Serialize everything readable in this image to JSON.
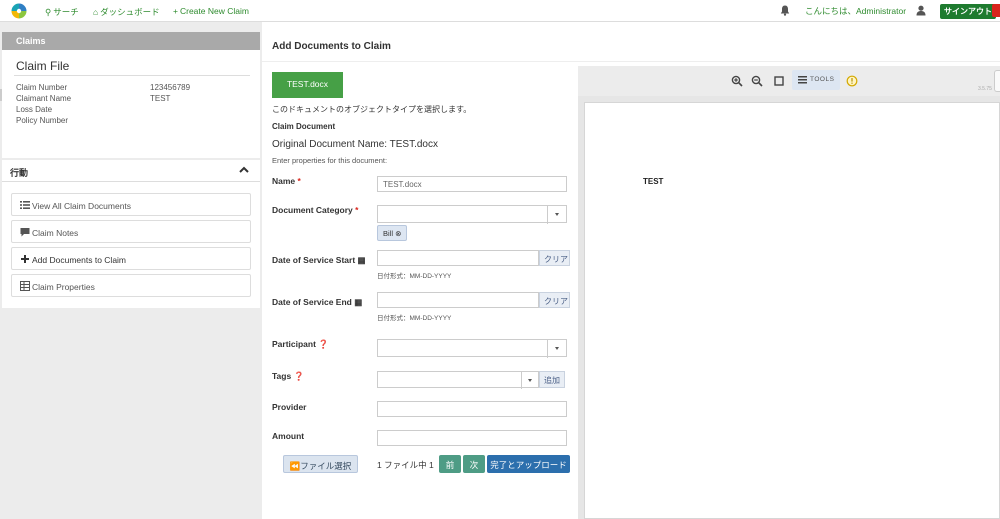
{
  "nav": {
    "search": "サーチ",
    "dashboard": "ダッシュボード",
    "create": "Create New Claim",
    "greeting": "こんにちは、Administrator",
    "signout": "サインアウト"
  },
  "left": {
    "claims_header": "Claims",
    "claim_file_title": "Claim File",
    "fields": [
      {
        "label": "Claim Number",
        "value": "123456789"
      },
      {
        "label": "Claimant Name",
        "value": "TEST"
      },
      {
        "label": "Loss Date",
        "value": ""
      },
      {
        "label": "Policy Number",
        "value": ""
      }
    ],
    "actions_title": "行動",
    "actions": [
      {
        "label": "View All Claim Documents",
        "icon": "list-icon"
      },
      {
        "label": "Claim Notes",
        "icon": "comment-icon"
      },
      {
        "label": "Add Documents to Claim",
        "icon": "plus-icon"
      },
      {
        "label": "Claim Properties",
        "icon": "table-icon"
      }
    ]
  },
  "page": {
    "title": "Add Documents to Claim"
  },
  "form": {
    "file_tab": "TEST.docx",
    "select_type_text": "このドキュメントのオブジェクトタイプを選択します。",
    "object_type": "Claim Document",
    "original_name": "Original Document Name: TEST.docx",
    "enter_props": "Enter properties for this document:",
    "name_label": "Name",
    "name_value": "TEST.docx",
    "doc_category_label": "Document Category",
    "doc_category_chip": "Bill",
    "dos_start_label": "Date of Service Start",
    "dos_end_label": "Date of Service End",
    "clear": "クリア",
    "date_hint": "日付形式：MM-DD-YYYY",
    "participant_label": "Participant",
    "tags_label": "Tags",
    "add": "追加",
    "provider_label": "Provider",
    "amount_label": "Amount",
    "file_select": "ファイル選択",
    "file_count": "1 ファイル中 1",
    "prev": "前",
    "next": "次",
    "finish_upload": "完了とアップロード"
  },
  "viewer": {
    "tools": "TOOLS",
    "version": "3.5.75",
    "page_text": "TEST"
  },
  "colors": {
    "accent_green": "#2e8b2e",
    "tab_green": "#46a046",
    "btn_teal": "#4e9c85",
    "btn_blue": "#2c6fad"
  }
}
